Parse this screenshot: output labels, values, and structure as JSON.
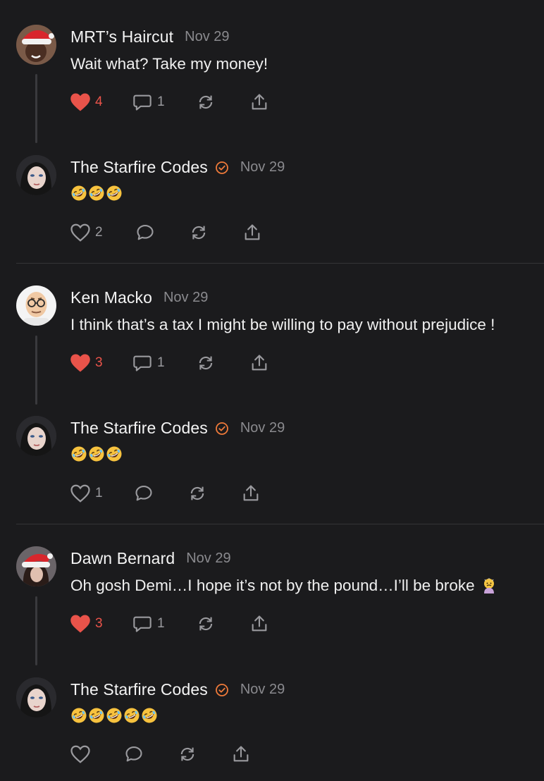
{
  "colors": {
    "background": "#1b1b1d",
    "liked": "#e9534a",
    "verified": "#ef7a3a",
    "muted": "#8a8a8e"
  },
  "comments": [
    {
      "author": "MRT’s Haircut",
      "date": "Nov 29",
      "text": "Wait what? Take my money!",
      "verified": false,
      "liked": true,
      "likes": "4",
      "replies": "1",
      "avatar_icon": "santa-hat-avatar-icon"
    },
    {
      "author": "The Starfire Codes",
      "date": "Nov 29",
      "emoji_count": 3,
      "emoji": "rolling-on-floor-laughing-icon",
      "verified": true,
      "liked": false,
      "likes": "2",
      "replies": "",
      "avatar_icon": "woman-portrait-avatar-icon"
    },
    {
      "author": "Ken Macko",
      "date": "Nov 29",
      "text": "I think that’s a tax I might be willing to pay without prejudice !",
      "verified": false,
      "liked": true,
      "likes": "3",
      "replies": "1",
      "avatar_icon": "cartoon-man-glasses-avatar-icon"
    },
    {
      "author": "The Starfire Codes",
      "date": "Nov 29",
      "emoji_count": 3,
      "emoji": "rolling-on-floor-laughing-icon",
      "verified": true,
      "liked": false,
      "likes": "1",
      "replies": "",
      "avatar_icon": "woman-portrait-avatar-icon"
    },
    {
      "author": "Dawn Bernard",
      "date": "Nov 29",
      "text": "Oh gosh Demi…I hope it’s not by the pound…I’ll be broke",
      "text_emoji": "person-crying-icon",
      "verified": false,
      "liked": true,
      "likes": "3",
      "replies": "1",
      "avatar_icon": "santa-hat-woman-avatar-icon"
    },
    {
      "author": "The Starfire Codes",
      "date": "Nov 29",
      "emoji_count": 5,
      "emoji": "rolling-on-floor-laughing-icon",
      "verified": true,
      "liked": false,
      "likes": "",
      "replies": "",
      "avatar_icon": "woman-portrait-avatar-icon"
    }
  ]
}
